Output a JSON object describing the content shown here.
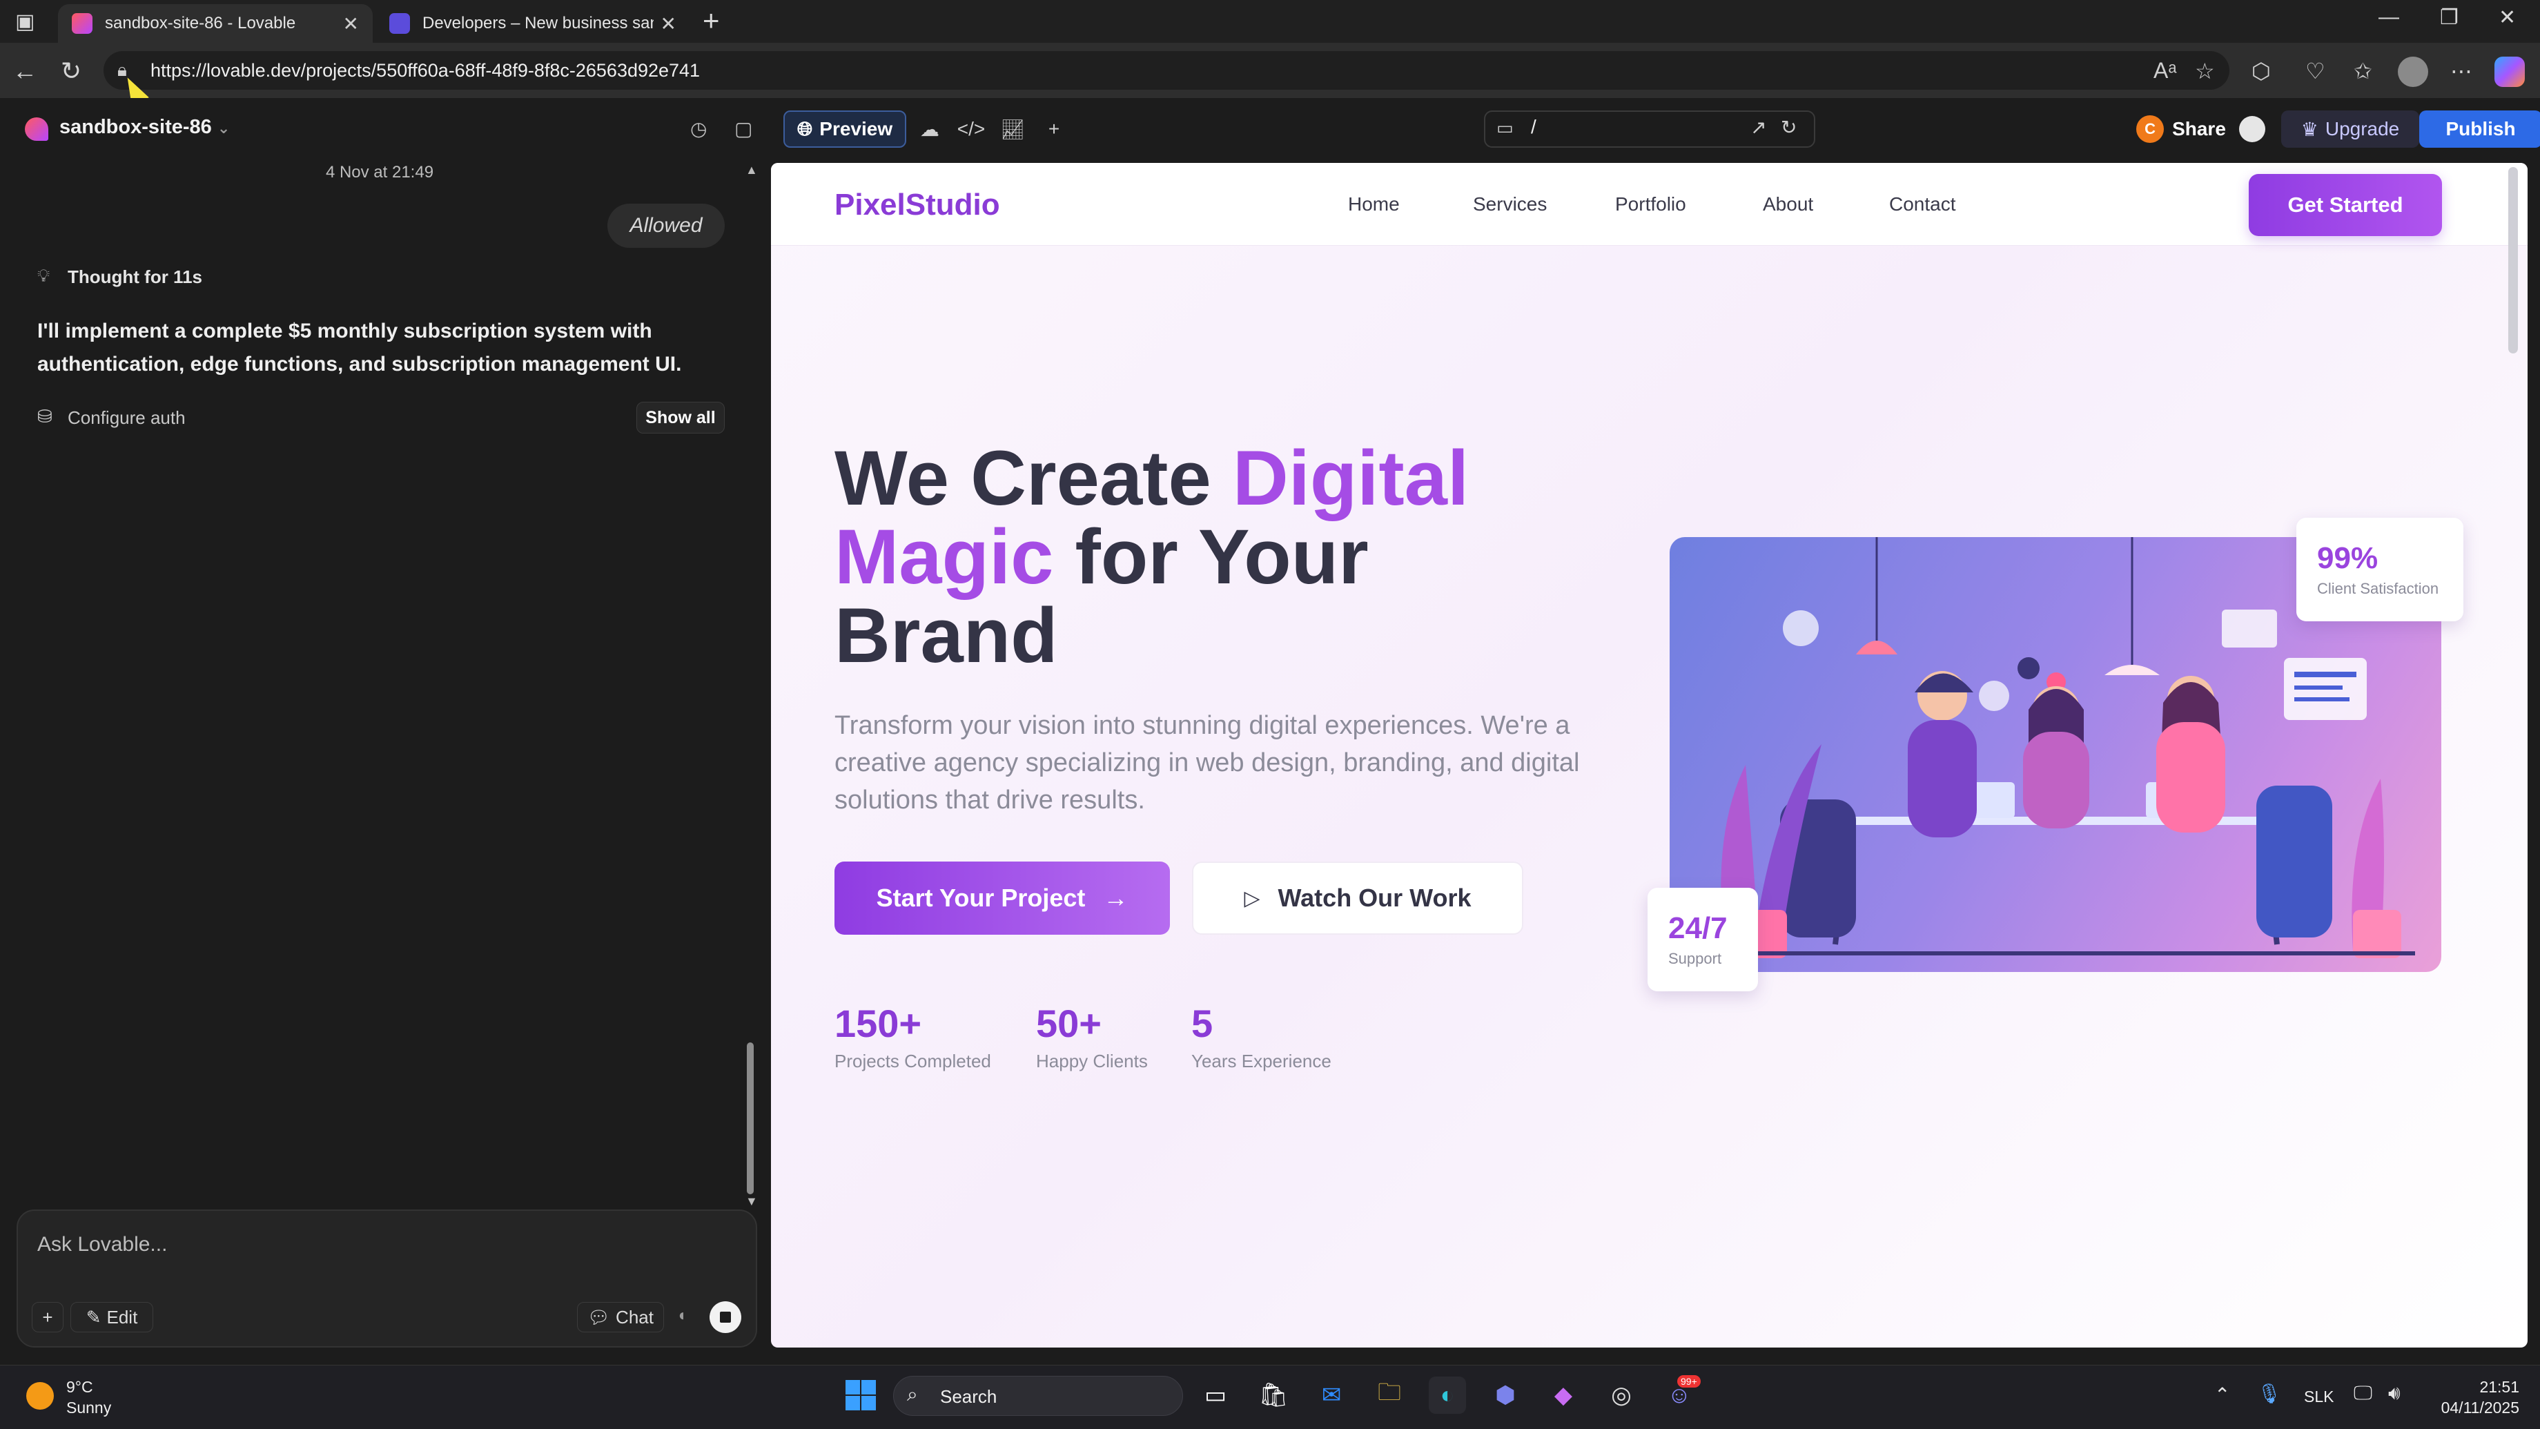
{
  "browser": {
    "tabs": [
      {
        "title": "sandbox-site-86 - Lovable",
        "close": "✕"
      },
      {
        "title": "Developers – New business sandb",
        "close": "✕"
      }
    ],
    "new_tab": "+",
    "url": "https://lovable.dev/projects/550ff60a-68ff-48f9-8f8c-26563d92e741"
  },
  "lovable": {
    "project_name": "sandbox-site-86",
    "preview_label": "Preview",
    "path": "/",
    "share_label": "Share",
    "upgrade_label": "Upgrade",
    "publish_label": "Publish",
    "avatar_letter": "C"
  },
  "chat": {
    "date": "4 Nov at 21:49",
    "allowed_badge": "Allowed",
    "thought": "Thought for 11s",
    "message": "I'll implement a complete $5 monthly subscription system with authentication, edge functions, and subscription management UI.",
    "configure": "Configure auth",
    "show_all": "Show all",
    "input_placeholder": "Ask Lovable...",
    "plus": "+",
    "edit_label": "Edit",
    "chat_label": "Chat"
  },
  "site": {
    "brand": "PixelStudio",
    "nav": [
      "Home",
      "Services",
      "Portfolio",
      "About",
      "Contact"
    ],
    "cta": "Get Started",
    "title_part1": "We Create ",
    "title_accent1": "Digital",
    "title_accent2": "Magic",
    "title_part2": " for Your",
    "title_part3": "Brand",
    "subtitle": "Transform your vision into stunning digital experiences. We're a creative agency specializing in web design, branding, and digital solutions that drive results.",
    "start_button": "Start Your Project",
    "start_arrow": "→",
    "watch_button": "Watch Our Work",
    "stats": [
      {
        "value": "150+",
        "label": "Projects Completed"
      },
      {
        "value": "50+",
        "label": "Happy Clients"
      },
      {
        "value": "5",
        "label": "Years Experience"
      }
    ],
    "satisfaction": {
      "value": "99%",
      "label": "Client Satisfaction"
    },
    "support": {
      "value": "24/7",
      "label": "Support"
    }
  },
  "taskbar": {
    "temperature": "9°C",
    "condition": "Sunny",
    "search": "Search",
    "language": "SLK",
    "time": "21:51",
    "date": "04/11/2025",
    "badge": "99+"
  },
  "colors": {
    "accent": "#8a3bd6",
    "publish": "#2d6ae6",
    "dark_bg": "#1c1c1c"
  }
}
